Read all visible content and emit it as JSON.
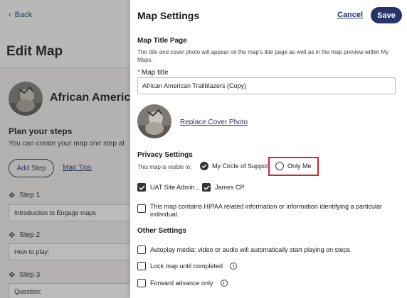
{
  "background": {
    "back_label": "Back",
    "page_title": "Edit Map",
    "map_name": "African Americ",
    "plan_heading": "Plan your steps",
    "plan_subtext": "You can create your map one step at",
    "add_step_label": "Add Step",
    "map_tips_label": "Map Tips",
    "steps": [
      {
        "label": "Step 1",
        "value": "Introduction to Engage maps"
      },
      {
        "label": "Step 2",
        "value": "How to play:"
      },
      {
        "label": "Step 3",
        "value": "Question:"
      }
    ]
  },
  "drawer": {
    "title": "Map Settings",
    "cancel_label": "Cancel",
    "save_label": "Save",
    "title_page_heading": "Map Title Page",
    "title_page_desc": "The title and cover photo will appear on the map's title page as well as in the map preview within My Maps.",
    "required_mark": "*",
    "map_title_label": "Map title",
    "map_title_value": "African American Trailblazers (Copy)",
    "replace_cover_label": "Replace Cover Photo",
    "privacy_heading": "Privacy Settings",
    "visible_to_label": "This map is visible to:",
    "visibility_options": [
      {
        "label": "My Circle of Support",
        "selected": true
      },
      {
        "label": "Only Me",
        "selected": false
      }
    ],
    "circle_members": [
      {
        "label": "UAT Site Admin...",
        "checked": true
      },
      {
        "label": "James CP",
        "checked": true
      }
    ],
    "hipaa_label": "This map contains HIPAA related information or information identifying a particular individual.",
    "other_heading": "Other Settings",
    "autoplay_label": "Autoplay media: video or audio will automatically start playing on steps",
    "lock_label": "Lock map until completed",
    "forward_label": "Forward advance only",
    "info_glyph": "i"
  },
  "colors": {
    "accent": "#27346b",
    "highlight": "#d0272e"
  },
  "icons": {
    "back": "chevron-left-icon",
    "move": "move-arrows-icon",
    "info": "info-icon"
  }
}
